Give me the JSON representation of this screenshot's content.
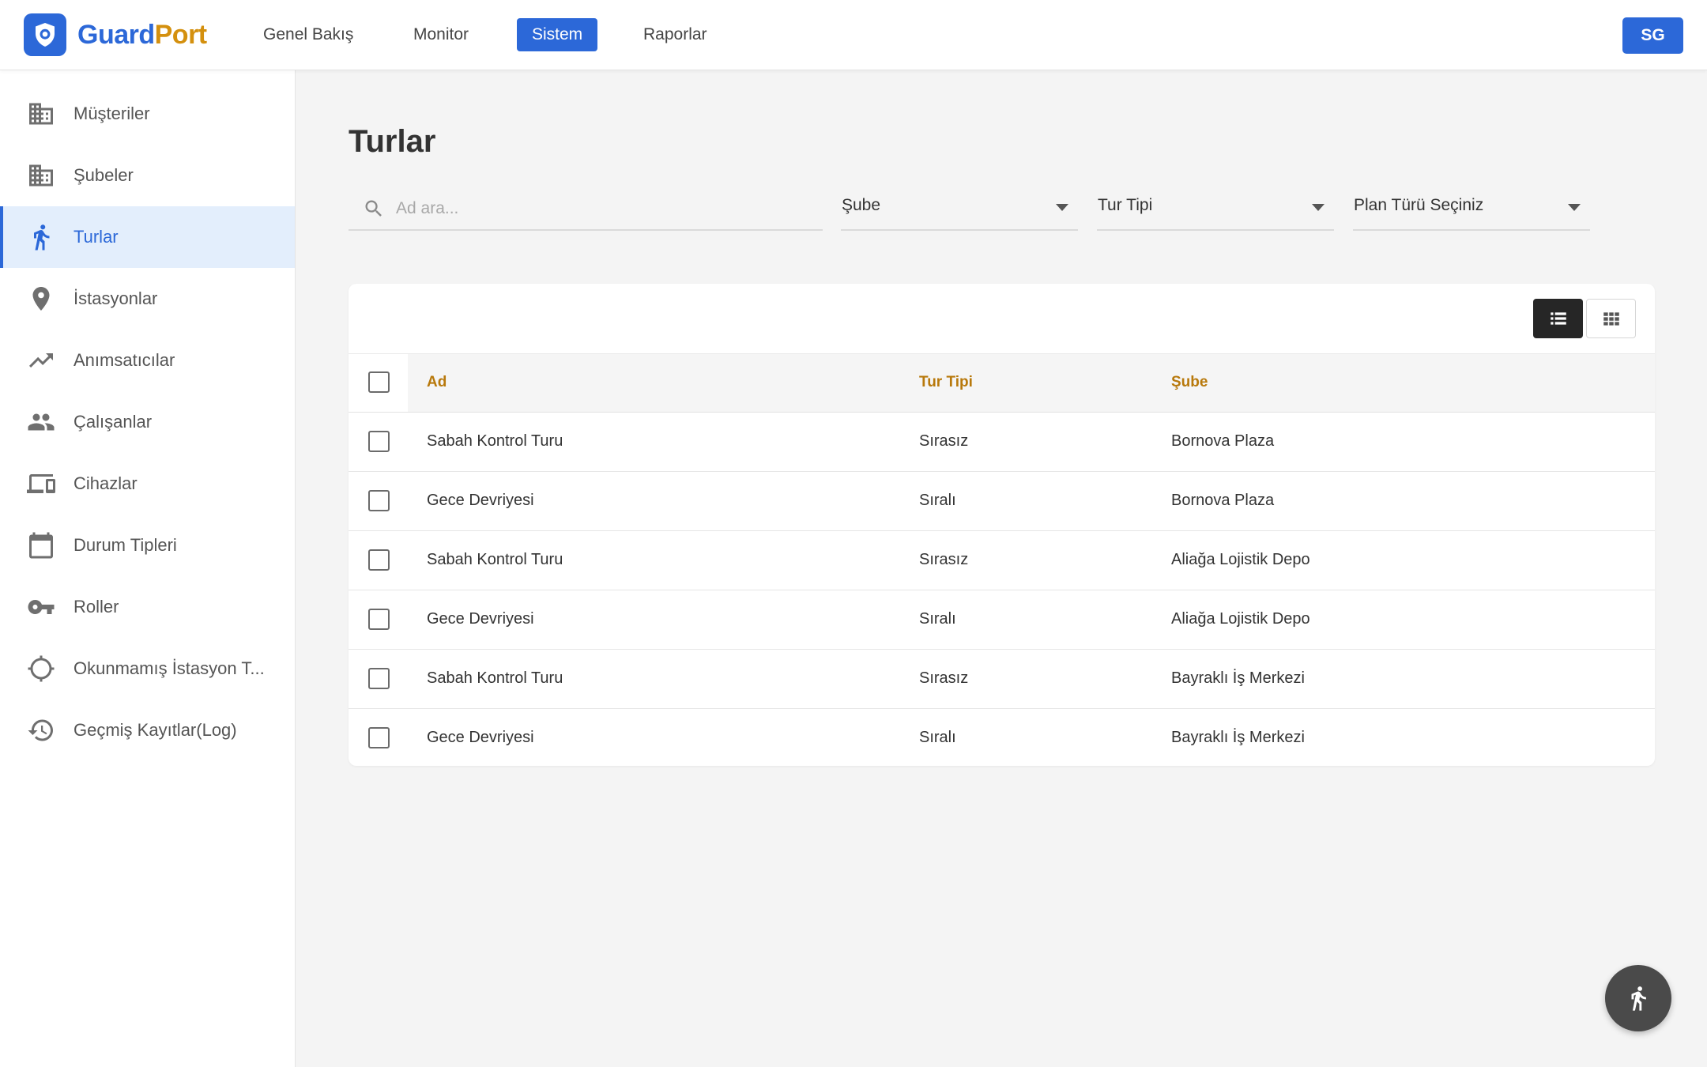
{
  "app": {
    "name_part1": "Guard",
    "name_part2": "Port",
    "brand_color": "#2c68d8",
    "accent_color": "#d4900e"
  },
  "nav": [
    {
      "label": "Genel Bakış",
      "active": false
    },
    {
      "label": "Monitor",
      "active": false
    },
    {
      "label": "Sistem",
      "active": true
    },
    {
      "label": "Raporlar",
      "active": false
    }
  ],
  "user": {
    "initials": "SG"
  },
  "sidebar": {
    "items": [
      {
        "label": "Müşteriler",
        "icon": "building-icon"
      },
      {
        "label": "Şubeler",
        "icon": "building-icon"
      },
      {
        "label": "Turlar",
        "icon": "walking-icon",
        "active": true
      },
      {
        "label": "İstasyonlar",
        "icon": "location-pin-icon"
      },
      {
        "label": "Anımsatıcılar",
        "icon": "trending-up-icon"
      },
      {
        "label": "Çalışanlar",
        "icon": "people-icon"
      },
      {
        "label": "Cihazlar",
        "icon": "devices-icon"
      },
      {
        "label": "Durum Tipleri",
        "icon": "calendar-icon"
      },
      {
        "label": "Roller",
        "icon": "key-icon"
      },
      {
        "label": "Okunmamış İstasyon T...",
        "icon": "crosshair-icon"
      },
      {
        "label": "Geçmiş Kayıtlar(Log)",
        "icon": "history-icon"
      }
    ]
  },
  "page": {
    "title": "Turlar"
  },
  "filters": {
    "search_placeholder": "Ad ara...",
    "branch": "Şube",
    "tour_type": "Tur Tipi",
    "plan_type": "Plan Türü Seçiniz"
  },
  "table": {
    "columns": [
      "Ad",
      "Tur Tipi",
      "Şube"
    ],
    "rows": [
      [
        "Sabah Kontrol Turu",
        "Sırasız",
        "Bornova Plaza"
      ],
      [
        "Gece Devriyesi",
        "Sıralı",
        "Bornova Plaza"
      ],
      [
        "Sabah Kontrol Turu",
        "Sırasız",
        "Aliağa Lojistik Depo"
      ],
      [
        "Gece Devriyesi",
        "Sıralı",
        "Aliağa Lojistik Depo"
      ],
      [
        "Sabah Kontrol Turu",
        "Sırasız",
        "Bayraklı İş Merkezi"
      ],
      [
        "Gece Devriyesi",
        "Sıralı",
        "Bayraklı İş Merkezi"
      ]
    ]
  }
}
